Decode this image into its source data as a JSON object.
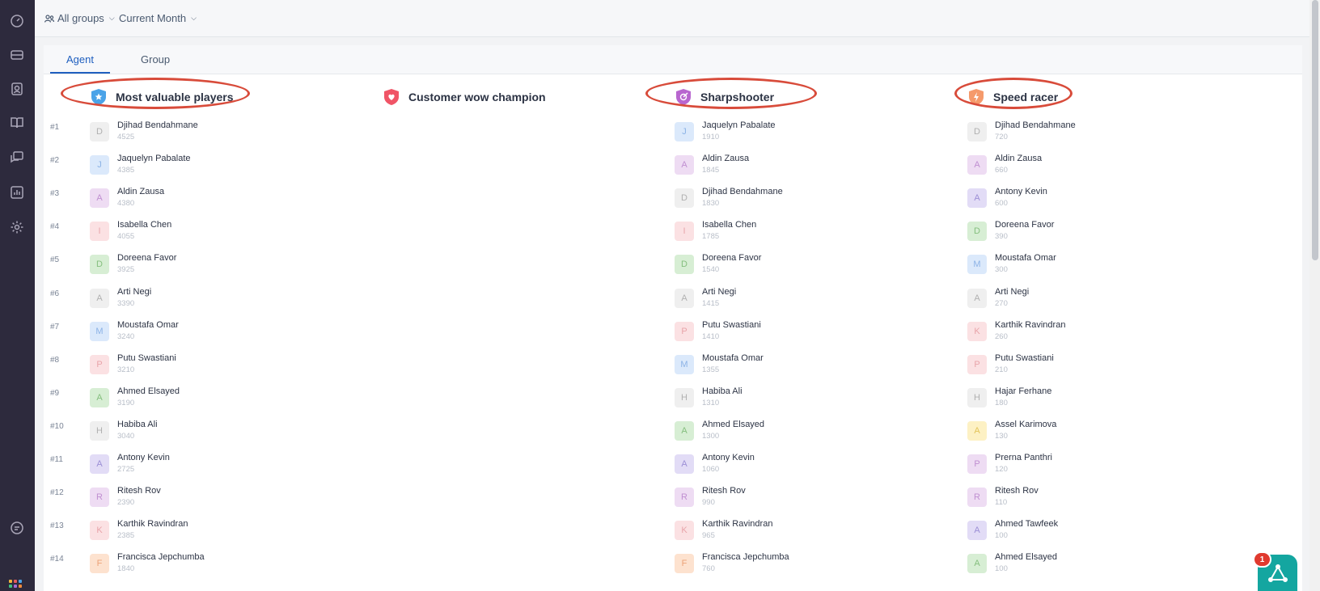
{
  "topbar": {
    "groups_filter": "All groups",
    "period_filter": "Current Month"
  },
  "tabs": [
    {
      "label": "Agent",
      "active": true
    },
    {
      "label": "Group",
      "active": false
    }
  ],
  "ranks": [
    "#1",
    "#2",
    "#3",
    "#4",
    "#5",
    "#6",
    "#7",
    "#8",
    "#9",
    "#10",
    "#11",
    "#12",
    "#13",
    "#14"
  ],
  "columns": [
    {
      "title": "Most valuable players",
      "badge_color": "#4aa3e8",
      "highlighted": true,
      "entries": [
        {
          "initial": "D",
          "name": "Djihad Bendahmane",
          "score": "4525",
          "bg": "#efefef",
          "fg": "#b0b0b0"
        },
        {
          "initial": "J",
          "name": "Jaquelyn Pabalate",
          "score": "4385",
          "bg": "#dbe9fb",
          "fg": "#8cb3e6"
        },
        {
          "initial": "A",
          "name": "Aldin Zausa",
          "score": "4380",
          "bg": "#eedcf3",
          "fg": "#c08fd1"
        },
        {
          "initial": "I",
          "name": "Isabella Chen",
          "score": "4055",
          "bg": "#fbe1e3",
          "fg": "#e8a4aa"
        },
        {
          "initial": "D",
          "name": "Doreena Favor",
          "score": "3925",
          "bg": "#d7eed4",
          "fg": "#85bf7e"
        },
        {
          "initial": "A",
          "name": "Arti Negi",
          "score": "3390",
          "bg": "#efefef",
          "fg": "#b0b0b0"
        },
        {
          "initial": "M",
          "name": "Moustafa Omar",
          "score": "3240",
          "bg": "#dbe9fb",
          "fg": "#8cb3e6"
        },
        {
          "initial": "P",
          "name": "Putu Swastiani",
          "score": "3210",
          "bg": "#fbe1e3",
          "fg": "#e8a4aa"
        },
        {
          "initial": "A",
          "name": "Ahmed Elsayed",
          "score": "3190",
          "bg": "#d7eed4",
          "fg": "#85bf7e"
        },
        {
          "initial": "H",
          "name": "Habiba Ali",
          "score": "3040",
          "bg": "#efefef",
          "fg": "#b0b0b0"
        },
        {
          "initial": "A",
          "name": "Antony Kevin",
          "score": "2725",
          "bg": "#e2dcf6",
          "fg": "#9c8fd6"
        },
        {
          "initial": "R",
          "name": "Ritesh Rov",
          "score": "2390",
          "bg": "#eedcf3",
          "fg": "#c08fd1"
        },
        {
          "initial": "K",
          "name": "Karthik Ravindran",
          "score": "2385",
          "bg": "#fbe1e3",
          "fg": "#e8a4aa"
        },
        {
          "initial": "F",
          "name": "Francisca Jepchumba",
          "score": "1840",
          "bg": "#fde2cf",
          "fg": "#eca277"
        }
      ]
    },
    {
      "title": "Customer wow champion",
      "badge_color": "#f05466",
      "highlighted": false,
      "entries": []
    },
    {
      "title": "Sharpshooter",
      "badge_color": "#b866cf",
      "highlighted": true,
      "entries": [
        {
          "initial": "J",
          "name": "Jaquelyn Pabalate",
          "score": "1910",
          "bg": "#dbe9fb",
          "fg": "#8cb3e6"
        },
        {
          "initial": "A",
          "name": "Aldin Zausa",
          "score": "1845",
          "bg": "#eedcf3",
          "fg": "#c08fd1"
        },
        {
          "initial": "D",
          "name": "Djihad Bendahmane",
          "score": "1830",
          "bg": "#efefef",
          "fg": "#b0b0b0"
        },
        {
          "initial": "I",
          "name": "Isabella Chen",
          "score": "1785",
          "bg": "#fbe1e3",
          "fg": "#e8a4aa"
        },
        {
          "initial": "D",
          "name": "Doreena Favor",
          "score": "1540",
          "bg": "#d7eed4",
          "fg": "#85bf7e"
        },
        {
          "initial": "A",
          "name": "Arti Negi",
          "score": "1415",
          "bg": "#efefef",
          "fg": "#b0b0b0"
        },
        {
          "initial": "P",
          "name": "Putu Swastiani",
          "score": "1410",
          "bg": "#fbe1e3",
          "fg": "#e8a4aa"
        },
        {
          "initial": "M",
          "name": "Moustafa Omar",
          "score": "1355",
          "bg": "#dbe9fb",
          "fg": "#8cb3e6"
        },
        {
          "initial": "H",
          "name": "Habiba Ali",
          "score": "1310",
          "bg": "#efefef",
          "fg": "#b0b0b0"
        },
        {
          "initial": "A",
          "name": "Ahmed Elsayed",
          "score": "1300",
          "bg": "#d7eed4",
          "fg": "#85bf7e"
        },
        {
          "initial": "A",
          "name": "Antony Kevin",
          "score": "1060",
          "bg": "#e2dcf6",
          "fg": "#9c8fd6"
        },
        {
          "initial": "R",
          "name": "Ritesh Rov",
          "score": "990",
          "bg": "#eedcf3",
          "fg": "#c08fd1"
        },
        {
          "initial": "K",
          "name": "Karthik Ravindran",
          "score": "965",
          "bg": "#fbe1e3",
          "fg": "#e8a4aa"
        },
        {
          "initial": "F",
          "name": "Francisca Jepchumba",
          "score": "760",
          "bg": "#fde2cf",
          "fg": "#eca277"
        }
      ]
    },
    {
      "title": "Speed racer",
      "badge_color": "#f59a6b",
      "highlighted": true,
      "entries": [
        {
          "initial": "D",
          "name": "Djihad Bendahmane",
          "score": "720",
          "bg": "#efefef",
          "fg": "#b0b0b0"
        },
        {
          "initial": "A",
          "name": "Aldin Zausa",
          "score": "660",
          "bg": "#eedcf3",
          "fg": "#c08fd1"
        },
        {
          "initial": "A",
          "name": "Antony Kevin",
          "score": "600",
          "bg": "#e2dcf6",
          "fg": "#9c8fd6"
        },
        {
          "initial": "D",
          "name": "Doreena Favor",
          "score": "390",
          "bg": "#d7eed4",
          "fg": "#85bf7e"
        },
        {
          "initial": "M",
          "name": "Moustafa Omar",
          "score": "300",
          "bg": "#dbe9fb",
          "fg": "#8cb3e6"
        },
        {
          "initial": "A",
          "name": "Arti Negi",
          "score": "270",
          "bg": "#efefef",
          "fg": "#b0b0b0"
        },
        {
          "initial": "K",
          "name": "Karthik Ravindran",
          "score": "260",
          "bg": "#fbe1e3",
          "fg": "#e8a4aa"
        },
        {
          "initial": "P",
          "name": "Putu Swastiani",
          "score": "210",
          "bg": "#fbe1e3",
          "fg": "#e8a4aa"
        },
        {
          "initial": "H",
          "name": "Hajar Ferhane",
          "score": "180",
          "bg": "#efefef",
          "fg": "#b0b0b0"
        },
        {
          "initial": "A",
          "name": "Assel Karimova",
          "score": "130",
          "bg": "#fdf1c4",
          "fg": "#e3c45a"
        },
        {
          "initial": "P",
          "name": "Prerna Panthri",
          "score": "120",
          "bg": "#eedcf3",
          "fg": "#c08fd1"
        },
        {
          "initial": "R",
          "name": "Ritesh Rov",
          "score": "110",
          "bg": "#eedcf3",
          "fg": "#c08fd1"
        },
        {
          "initial": "A",
          "name": "Ahmed Tawfeek",
          "score": "100",
          "bg": "#e2dcf6",
          "fg": "#9c8fd6"
        },
        {
          "initial": "A",
          "name": "Ahmed Elsayed",
          "score": "100",
          "bg": "#d7eed4",
          "fg": "#85bf7e"
        }
      ]
    }
  ],
  "notification": {
    "count": "1"
  },
  "colors": {
    "accent": "#1f5fbf",
    "highlight_ring": "#d84b3a",
    "nav_bg": "#2d2a3d",
    "helper": "#14a6a0"
  }
}
